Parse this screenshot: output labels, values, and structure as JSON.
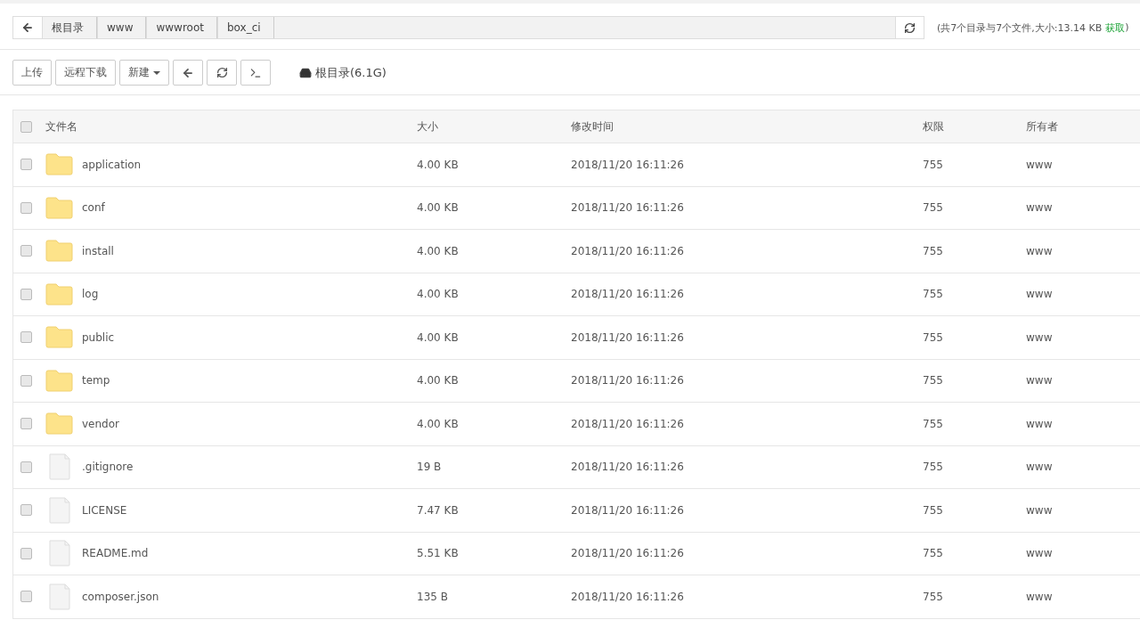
{
  "breadcrumb": {
    "segments": [
      "根目录",
      "www",
      "wwwroot",
      "box_ci"
    ]
  },
  "summary": {
    "text": "(共7个目录与7个文件,大小:13.14 KB",
    "link": "获取",
    "close": ")"
  },
  "toolbar": {
    "buttons": [
      {
        "kind": "text",
        "label": "上传"
      },
      {
        "kind": "text",
        "label": "远程下载"
      },
      {
        "kind": "dropdown",
        "label": "新建"
      },
      {
        "kind": "back"
      },
      {
        "kind": "refresh"
      },
      {
        "kind": "terminal"
      }
    ],
    "disk": "根目录(6.1G)"
  },
  "table": {
    "columns": [
      "文件名",
      "大小",
      "修改时间",
      "权限",
      "所有者"
    ],
    "header_checked": false,
    "rows": [
      {
        "kind": "folder",
        "name": "application",
        "size": "4.00 KB",
        "mtime": "2018/11/20 16:11:26",
        "perm": "755",
        "owner": "www",
        "checked": false
      },
      {
        "kind": "folder",
        "name": "conf",
        "size": "4.00 KB",
        "mtime": "2018/11/20 16:11:26",
        "perm": "755",
        "owner": "www",
        "checked": false
      },
      {
        "kind": "folder",
        "name": "install",
        "size": "4.00 KB",
        "mtime": "2018/11/20 16:11:26",
        "perm": "755",
        "owner": "www",
        "checked": false
      },
      {
        "kind": "folder",
        "name": "log",
        "size": "4.00 KB",
        "mtime": "2018/11/20 16:11:26",
        "perm": "755",
        "owner": "www",
        "checked": false
      },
      {
        "kind": "folder",
        "name": "public",
        "size": "4.00 KB",
        "mtime": "2018/11/20 16:11:26",
        "perm": "755",
        "owner": "www",
        "checked": false
      },
      {
        "kind": "folder",
        "name": "temp",
        "size": "4.00 KB",
        "mtime": "2018/11/20 16:11:26",
        "perm": "755",
        "owner": "www",
        "checked": false
      },
      {
        "kind": "folder",
        "name": "vendor",
        "size": "4.00 KB",
        "mtime": "2018/11/20 16:11:26",
        "perm": "755",
        "owner": "www",
        "checked": false
      },
      {
        "kind": "file",
        "name": ".gitignore",
        "size": "19 B",
        "mtime": "2018/11/20 16:11:26",
        "perm": "755",
        "owner": "www",
        "checked": false
      },
      {
        "kind": "file",
        "name": "LICENSE",
        "size": "7.47 KB",
        "mtime": "2018/11/20 16:11:26",
        "perm": "755",
        "owner": "www",
        "checked": false
      },
      {
        "kind": "file",
        "name": "README.md",
        "size": "5.51 KB",
        "mtime": "2018/11/20 16:11:26",
        "perm": "755",
        "owner": "www",
        "checked": false
      },
      {
        "kind": "file",
        "name": "composer.json",
        "size": "135 B",
        "mtime": "2018/11/20 16:11:26",
        "perm": "755",
        "owner": "www",
        "checked": false
      }
    ]
  }
}
